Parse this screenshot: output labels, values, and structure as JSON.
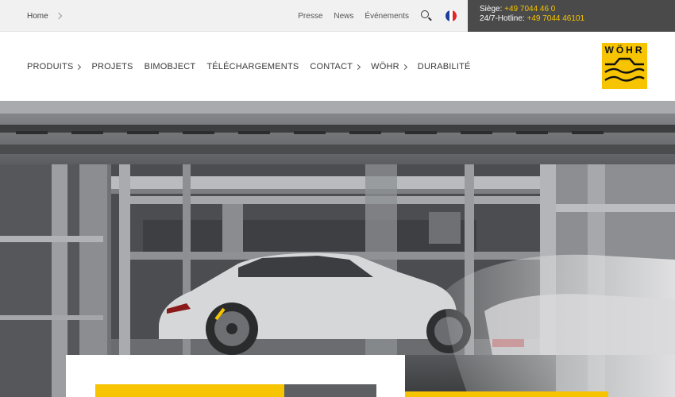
{
  "topbar": {
    "breadcrumb": "Home",
    "links": [
      "Presse",
      "News",
      "Événements"
    ],
    "search_icon": "search-icon",
    "language_icon": "flag-france-icon",
    "flag_colors": [
      "#1f3e9a",
      "#ffffff",
      "#e0262d"
    ],
    "contact": {
      "siege_label": "Siège:",
      "siege_phone": "+49 7044 46 0",
      "hotline_label": "24/7-Hotline:",
      "hotline_phone": "+49 7044 46101"
    }
  },
  "nav": {
    "items": [
      {
        "label": "PRODUITS",
        "has_submenu": true
      },
      {
        "label": "PROJETS",
        "has_submenu": false
      },
      {
        "label": "BIMOBJECT",
        "has_submenu": false
      },
      {
        "label": "TÉLÉCHARGEMENTS",
        "has_submenu": false
      },
      {
        "label": "CONTACT",
        "has_submenu": true
      },
      {
        "label": "WÖHR",
        "has_submenu": true
      },
      {
        "label": "DURABILITÉ",
        "has_submenu": false
      }
    ]
  },
  "logo": {
    "text": "WÖHR",
    "background": "#f6c400"
  },
  "colors": {
    "accent": "#f6c400",
    "contact_bg": "#4a4a4a",
    "topbar_bg": "#f1f1f1"
  }
}
